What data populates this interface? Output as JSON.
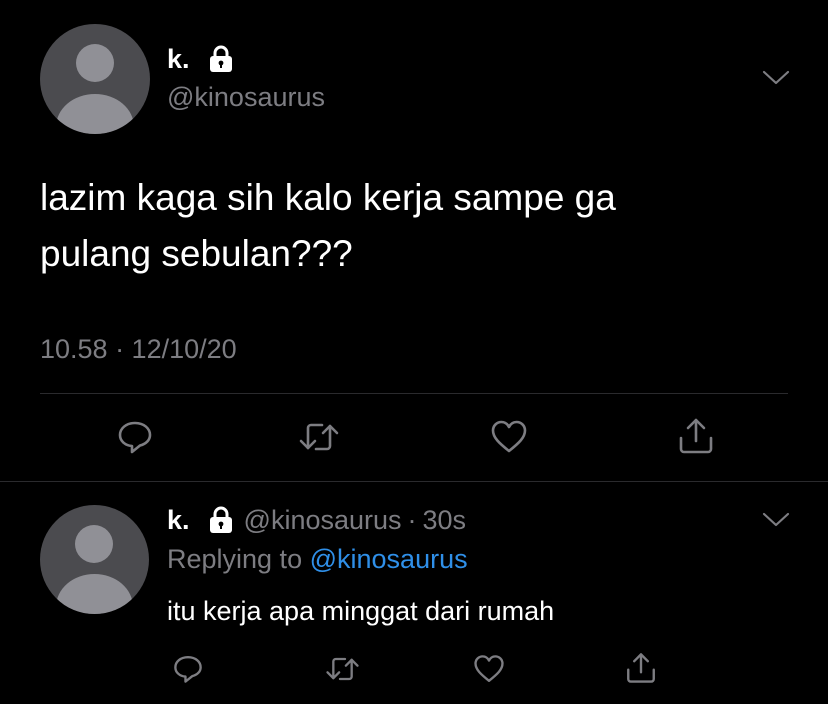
{
  "tweet": {
    "display_name": "k.",
    "handle": "@kinosaurus",
    "text_line1": "lazim kaga sih kalo kerja sampe ga",
    "text_line2": "pulang sebulan???",
    "timestamp": "10.58 · 12/10/20"
  },
  "reply": {
    "display_name": "k.",
    "handle": "@kinosaurus",
    "separator": "·",
    "time": "30s",
    "replying_prefix": "Replying to",
    "replying_handle": "@kinosaurus",
    "text": "itu kerja apa minggat dari rumah"
  },
  "icons": [
    "lock-icon",
    "chevron-down-icon",
    "reply-icon",
    "retweet-icon",
    "like-icon",
    "share-icon"
  ],
  "colors": {
    "background": "#000000",
    "text": "#ffffff",
    "muted": "#7d7d82",
    "link": "#2f8fe8",
    "avatar_bg": "#4b4b4f",
    "avatar_fg": "#909096"
  }
}
